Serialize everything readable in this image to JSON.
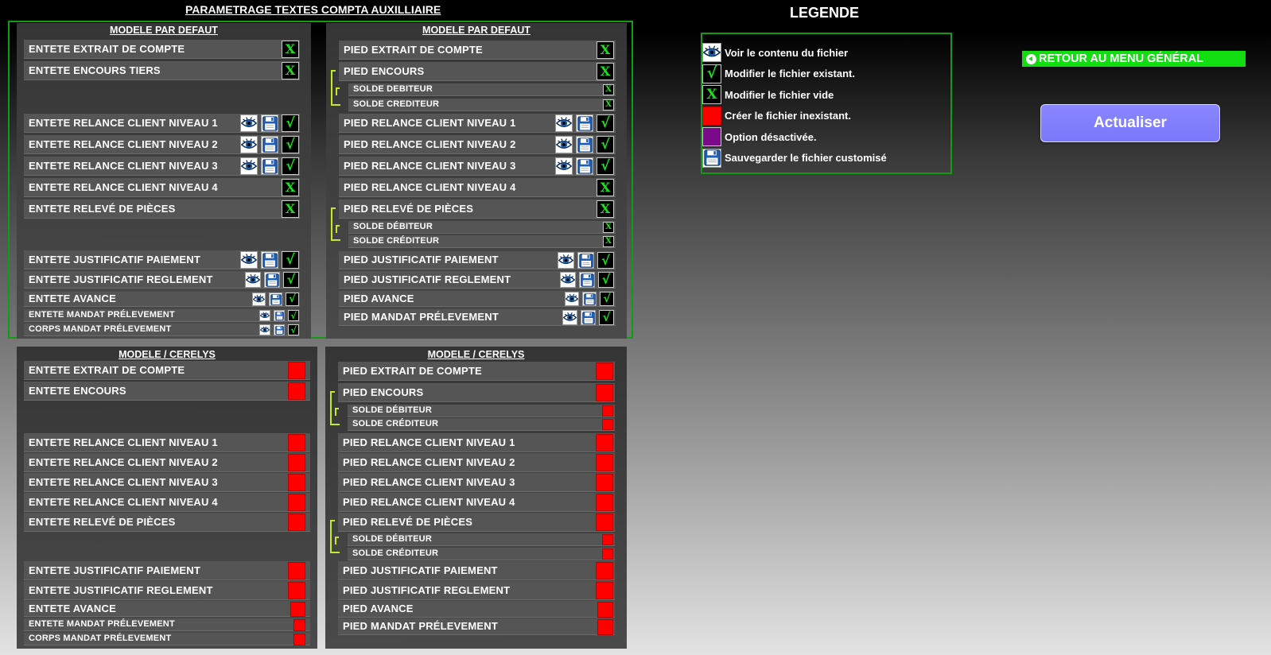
{
  "page": {
    "title": "PARAMETRAGE TEXTES COMPTA AUXILLIAIRE"
  },
  "colors": {
    "frame": "#139c13",
    "check": "#19e019",
    "red": "#ff0000",
    "purple": "#7a0a8a",
    "bracket": "#c6e82a",
    "retour": "#11dd11",
    "actualiser": "#8a86ff"
  },
  "panels": {
    "defaut_entete": {
      "title": "MODELE PAR DEFAUT"
    },
    "defaut_pied": {
      "title": "MODELE PAR DEFAUT"
    },
    "cerelys_entete": {
      "title": "MODELE / CERELYS"
    },
    "cerelys_pied": {
      "title": "MODELE / CERELYS"
    }
  },
  "defaut_entete_rows": [
    {
      "label": "ENTETE EXTRAIT DE COMPTE",
      "icons": [
        "x"
      ]
    },
    {
      "label": "ENTETE ENCOURS TIERS",
      "icons": [
        "x"
      ]
    },
    {
      "label": "ENTETE RELANCE CLIENT NIVEAU 1",
      "icons": [
        "eye",
        "save",
        "check"
      ]
    },
    {
      "label": "ENTETE RELANCE CLIENT NIVEAU 2",
      "icons": [
        "eye",
        "save",
        "check"
      ]
    },
    {
      "label": "ENTETE RELANCE CLIENT NIVEAU 3",
      "icons": [
        "eye",
        "save",
        "check"
      ]
    },
    {
      "label": "ENTETE RELANCE CLIENT NIVEAU 4",
      "icons": [
        "x"
      ]
    },
    {
      "label": "ENTETE RELEVÉ DE PIÈCES",
      "icons": [
        "x"
      ]
    },
    {
      "label": "ENTETE JUSTIFICATIF PAIEMENT",
      "icons": [
        "eye",
        "save",
        "check"
      ]
    },
    {
      "label": "ENTETE JUSTIFICATIF REGLEMENT",
      "icons": [
        "eye",
        "save",
        "check"
      ]
    },
    {
      "label": "ENTETE AVANCE",
      "icons": [
        "eye",
        "save",
        "check"
      ]
    },
    {
      "label": "ENTETE MANDAT PRÉLEVEMENT",
      "icons": [
        "eye",
        "save",
        "check"
      ]
    },
    {
      "label": "CORPS MANDAT PRÉLEVEMENT",
      "icons": [
        "eye",
        "save",
        "check"
      ]
    }
  ],
  "defaut_pied_rows": [
    {
      "label": "PIED EXTRAIT DE COMPTE",
      "icons": [
        "x"
      ]
    },
    {
      "label": "PIED ENCOURS",
      "icons": [
        "x"
      ]
    },
    {
      "label": "SOLDE DEBITEUR",
      "icons": [
        "x"
      ]
    },
    {
      "label": "SOLDE CREDITEUR",
      "icons": [
        "x"
      ]
    },
    {
      "label": "PIED RELANCE CLIENT NIVEAU 1",
      "icons": [
        "eye",
        "save",
        "check"
      ]
    },
    {
      "label": "PIED RELANCE CLIENT NIVEAU 2",
      "icons": [
        "eye",
        "save",
        "check"
      ]
    },
    {
      "label": "PIED RELANCE CLIENT NIVEAU 3",
      "icons": [
        "eye",
        "save",
        "check"
      ]
    },
    {
      "label": "PIED RELANCE CLIENT NIVEAU 4",
      "icons": [
        "x"
      ]
    },
    {
      "label": "PIED RELEVÉ DE PIÈCES",
      "icons": [
        "x"
      ]
    },
    {
      "label": "SOLDE DÉBITEUR",
      "icons": [
        "x"
      ]
    },
    {
      "label": "SOLDE CRÉDITEUR",
      "icons": [
        "x"
      ]
    },
    {
      "label": "PIED JUSTIFICATIF PAIEMENT",
      "icons": [
        "eye",
        "save",
        "check"
      ]
    },
    {
      "label": "PIED JUSTIFICATIF REGLEMENT",
      "icons": [
        "eye",
        "save",
        "check"
      ]
    },
    {
      "label": "PIED AVANCE",
      "icons": [
        "eye",
        "save",
        "check"
      ]
    },
    {
      "label": "PIED MANDAT PRÉLEVEMENT",
      "icons": [
        "eye",
        "save",
        "check"
      ]
    }
  ],
  "cerelys_entete_rows": [
    {
      "label": "ENTETE EXTRAIT DE COMPTE",
      "icons": [
        "red"
      ]
    },
    {
      "label": "ENTETE ENCOURS",
      "icons": [
        "red"
      ]
    },
    {
      "label": "ENTETE RELANCE CLIENT NIVEAU 1",
      "icons": [
        "red"
      ]
    },
    {
      "label": "ENTETE RELANCE CLIENT NIVEAU 2",
      "icons": [
        "red"
      ]
    },
    {
      "label": "ENTETE RELANCE CLIENT NIVEAU 3",
      "icons": [
        "red"
      ]
    },
    {
      "label": "ENTETE RELANCE CLIENT NIVEAU 4",
      "icons": [
        "red"
      ]
    },
    {
      "label": "ENTETE RELEVÉ DE PIÈCES",
      "icons": [
        "red"
      ]
    },
    {
      "label": "ENTETE JUSTIFICATIF PAIEMENT",
      "icons": [
        "red"
      ]
    },
    {
      "label": "ENTETE JUSTIFICATIF REGLEMENT",
      "icons": [
        "red"
      ]
    },
    {
      "label": "ENTETE AVANCE",
      "icons": [
        "red"
      ]
    },
    {
      "label": "ENTETE MANDAT PRÉLEVEMENT",
      "icons": [
        "red"
      ]
    },
    {
      "label": "CORPS MANDAT PRÉLEVEMENT",
      "icons": [
        "red"
      ]
    }
  ],
  "cerelys_pied_rows": [
    {
      "label": "PIED EXTRAIT DE COMPTE",
      "icons": [
        "red"
      ]
    },
    {
      "label": "PIED ENCOURS",
      "icons": [
        "red"
      ]
    },
    {
      "label": "SOLDE DÉBITEUR",
      "icons": [
        "red"
      ]
    },
    {
      "label": "SOLDE CRÉDITEUR",
      "icons": [
        "red"
      ]
    },
    {
      "label": "PIED RELANCE CLIENT NIVEAU 1",
      "icons": [
        "red"
      ]
    },
    {
      "label": "PIED RELANCE CLIENT NIVEAU 2",
      "icons": [
        "red"
      ]
    },
    {
      "label": "PIED RELANCE CLIENT NIVEAU 3",
      "icons": [
        "red"
      ]
    },
    {
      "label": "PIED RELANCE CLIENT NIVEAU 4",
      "icons": [
        "red"
      ]
    },
    {
      "label": "PIED RELEVÉ DE PIÈCES",
      "icons": [
        "red"
      ]
    },
    {
      "label": "SOLDE DÉBITEUR",
      "icons": [
        "red"
      ]
    },
    {
      "label": "SOLDE CRÉDITEUR",
      "icons": [
        "red"
      ]
    },
    {
      "label": "PIED JUSTIFICATIF PAIEMENT",
      "icons": [
        "red"
      ]
    },
    {
      "label": "PIED JUSTIFICATIF REGLEMENT",
      "icons": [
        "red"
      ]
    },
    {
      "label": "PIED AVANCE",
      "icons": [
        "red"
      ]
    },
    {
      "label": "PIED MANDAT PRÉLEVEMENT",
      "icons": [
        "red"
      ]
    }
  ],
  "legend": {
    "title": "LEGENDE",
    "items": [
      {
        "icon": "eye",
        "text": "Voir le contenu du fichier"
      },
      {
        "icon": "check",
        "text": "Modifier le fichier existant."
      },
      {
        "icon": "x",
        "text": "Modifier le fichier vide"
      },
      {
        "icon": "red",
        "text": "Créer le fichier inexistant."
      },
      {
        "icon": "purple",
        "text": "Option désactivée."
      },
      {
        "icon": "save",
        "text": "Sauvegarder le fichier customisé"
      }
    ]
  },
  "buttons": {
    "retour": "RETOUR AU MENU GÉNÉRAL",
    "actualiser": "Actualiser"
  },
  "icon_glyphs": {
    "check": "√",
    "x": "X"
  }
}
